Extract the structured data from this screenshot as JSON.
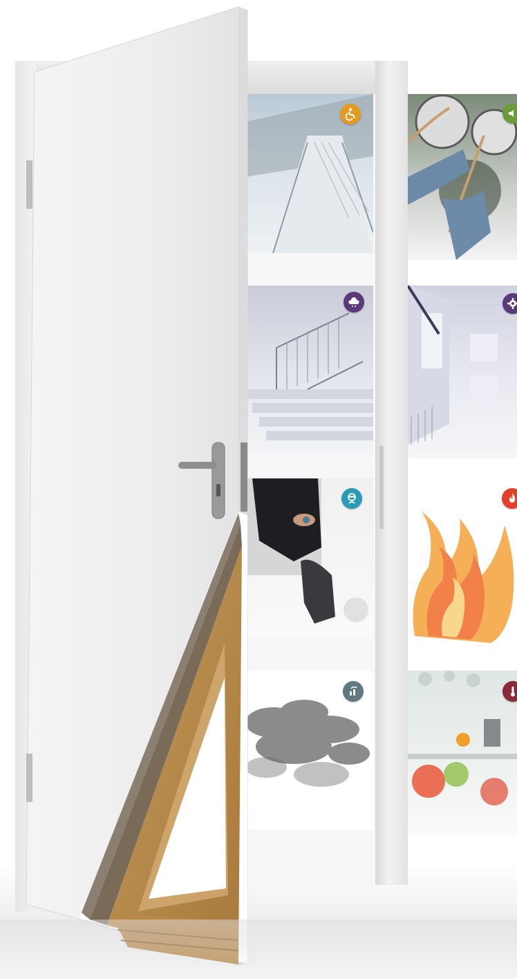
{
  "scene": {
    "subject": "door-with-application-tiles"
  },
  "tiles": [
    {
      "id": "accessibility",
      "icon": "wheelchair-icon",
      "color": "#e39a1e"
    },
    {
      "id": "sound",
      "icon": "speaker-icon",
      "color": "#6e9a3a"
    },
    {
      "id": "smoke-cloud",
      "icon": "cloud-icon",
      "color": "#5b3a78"
    },
    {
      "id": "gear",
      "icon": "gear-icon",
      "color": "#5b3a78"
    },
    {
      "id": "burglar",
      "icon": "burglar-icon",
      "color": "#2a9bb5"
    },
    {
      "id": "fire",
      "icon": "flame-icon",
      "color": "#e2402a"
    },
    {
      "id": "smoke",
      "icon": "smoke-icon",
      "color": "#5e7a80"
    },
    {
      "id": "temperature",
      "icon": "thermometer-icon",
      "color": "#8a2a3a"
    }
  ]
}
